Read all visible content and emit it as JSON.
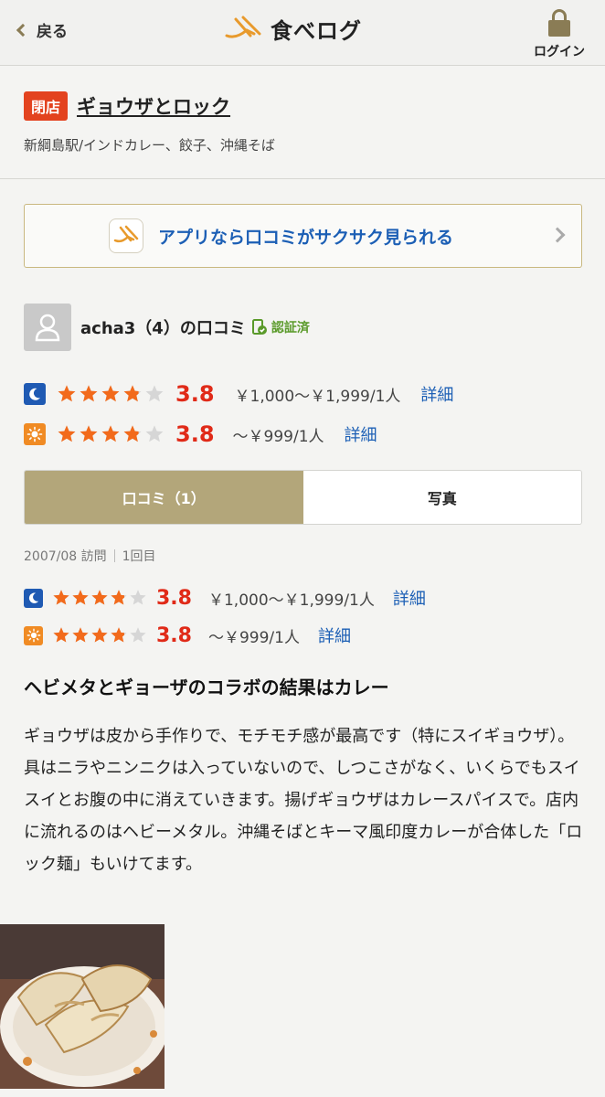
{
  "header": {
    "back_label": "戻る",
    "brand_name": "食べログ",
    "login_label": "ログイン"
  },
  "shop": {
    "status_badge": "閉店",
    "name": "ギョウザとロック",
    "subtitle": "新綱島駅/インドカレー、餃子、沖縄そば"
  },
  "app_banner": {
    "text": "アプリなら口コミがサクサク見られる"
  },
  "reviewer": {
    "name_line": "acha3（4）の口コミ",
    "verified_label": "認証済"
  },
  "overall_ratings": [
    {
      "time": "night",
      "rating": 3.8,
      "score": "3.8",
      "price": "￥1,000～￥1,999/1人",
      "detail": "詳細"
    },
    {
      "time": "day",
      "rating": 3.8,
      "score": "3.8",
      "price": "～￥999/1人",
      "detail": "詳細"
    }
  ],
  "tabs": [
    {
      "label": "口コミ（1）",
      "active": true
    },
    {
      "label": "写真",
      "active": false
    }
  ],
  "visit": {
    "date": "2007/08 訪問",
    "count": "1回目"
  },
  "visit_ratings": [
    {
      "time": "night",
      "rating": 3.8,
      "score": "3.8",
      "price": "￥1,000～￥1,999/1人",
      "detail": "詳細"
    },
    {
      "time": "day",
      "rating": 3.8,
      "score": "3.8",
      "price": "～￥999/1人",
      "detail": "詳細"
    }
  ],
  "review": {
    "title": "ヘビメタとギョーザのコラボの結果はカレー",
    "body": "ギョウザは皮から手作りで、モチモチ感が最高です（特にスイギョウザ）。具はニラやニンニクは入っていないので、しつこさがなく、いくらでもスイスイとお腹の中に消えていきます。揚げギョウザはカレースパイスで。店内に流れるのはヘビーメタル。沖縄そばとキーマ風印度カレーが合体した「ロック麺」もいけてます。"
  },
  "colors": {
    "accent_gold": "#b3a67a",
    "closed_red": "#e3431f",
    "star_orange": "#f26a1b",
    "score_red": "#e02a18",
    "link_blue": "#1c5fb5"
  }
}
